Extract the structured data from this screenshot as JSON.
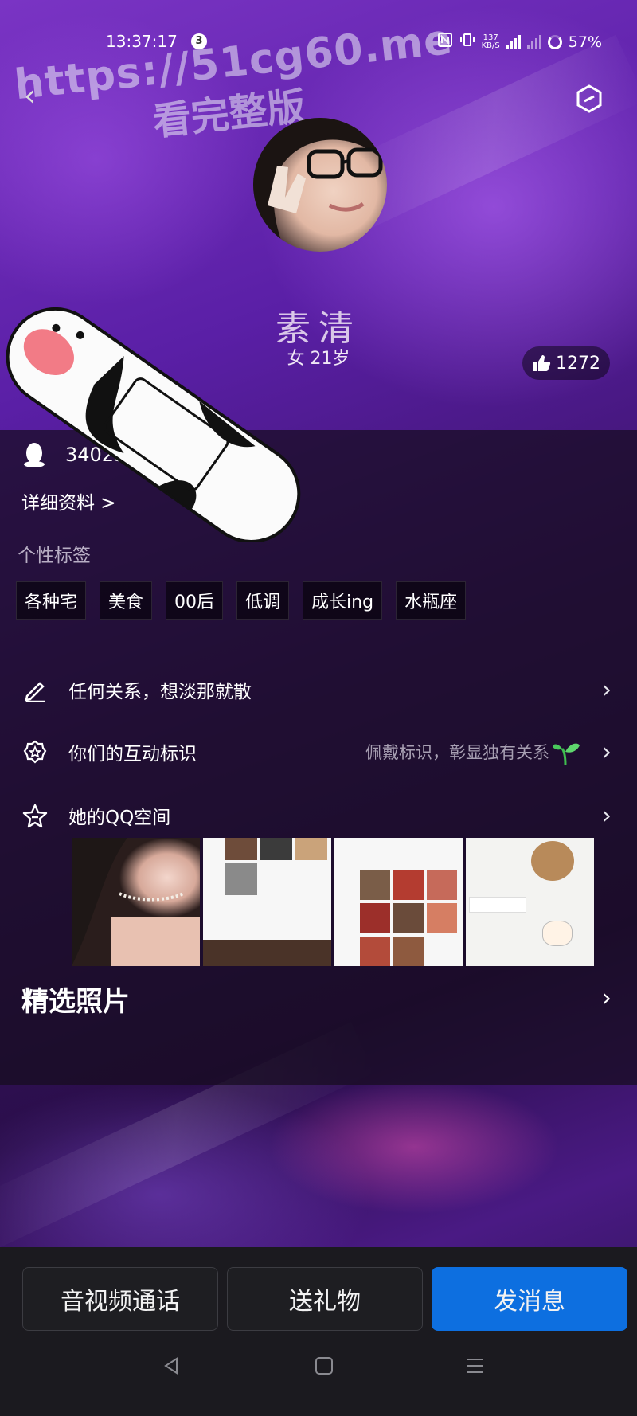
{
  "status_bar": {
    "time": "13:37:17",
    "notif_count": "3",
    "speed_value": "137",
    "speed_unit": "KB/S",
    "battery": "57%"
  },
  "watermark": {
    "line1": "https://51cg60.me",
    "line2": "看完整版"
  },
  "profile": {
    "nickname": "素清",
    "subtitle": "女 21岁",
    "likes": "1272",
    "qq_number": "34023"
  },
  "detail_link": "详细资料 >",
  "tags_section": {
    "label": "个性标签",
    "tags": [
      "各种宅",
      "美食",
      "00后",
      "低调",
      "成长ing",
      "水瓶座"
    ]
  },
  "rows": {
    "signature": "任何关系，想淡那就散",
    "interaction_label": "你们的互动标识",
    "interaction_hint": "佩戴标识，彰显独有关系",
    "qzone_label": "她的QQ空间"
  },
  "photos_title": "精选照片",
  "buttons": {
    "call": "音视频通话",
    "gift": "送礼物",
    "message": "发消息"
  },
  "icons": [
    "back-icon",
    "hexagon-icon",
    "like-icon",
    "qq-penguin-icon",
    "pencil-icon",
    "gear-badge-icon",
    "star-icon",
    "sprout-icon",
    "chevron-right-icon"
  ],
  "colors": {
    "primary": "#0d6fe0",
    "bottom_bar": "#1b1a1f"
  }
}
